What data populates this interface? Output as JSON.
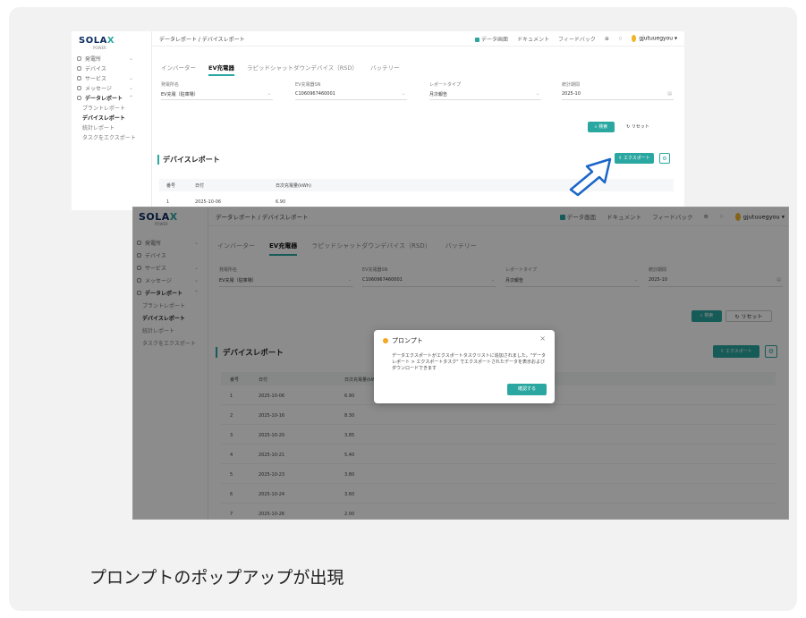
{
  "caption": "プロンプトのポップアップが出現",
  "colors": {
    "accent": "#2aa7a0",
    "card_bg": "#f2f2f2",
    "warning": "#f5a623",
    "arrow": "#1a66c8"
  },
  "logo": {
    "text_a": "SOLA",
    "text_x": "X",
    "sub": "POWER"
  },
  "header": {
    "breadcrumb": "データレポート / デバイスレポート",
    "data_screen": "データ画面",
    "documents": "ドキュメント",
    "feedback": "フィードバック",
    "username": "gjutuuegyou"
  },
  "sidebar": {
    "items": [
      {
        "label": "発電所"
      },
      {
        "label": "デバイス"
      },
      {
        "label": "サービス"
      },
      {
        "label": "メッセージ"
      },
      {
        "label": "データレポート"
      },
      {
        "label": "プラントレポート"
      },
      {
        "label": "デバイスレポート"
      },
      {
        "label": "統計レポート"
      },
      {
        "label": "タスクをエクスポート"
      }
    ]
  },
  "tabs": [
    "インバーター",
    "EV充電器",
    "ラピッドシャットダウンデバイス（RSD）",
    "バッテリー"
  ],
  "filters": {
    "plant_label": "発電所名",
    "plant_value": "EV充電（駐車場）",
    "sn_label": "EV充電器SN",
    "sn_value": "C1060967460001",
    "type_label": "レポートタイプ",
    "type_value": "月次報告",
    "period_label": "統計期間",
    "period_value": "2025-10"
  },
  "buttons": {
    "search": "検索",
    "reset": "リセット",
    "export": "エクスポート",
    "gear": "⚙"
  },
  "report": {
    "title": "デバイスレポート",
    "columns": [
      "番号",
      "日付",
      "日次充電量(kWh)"
    ],
    "rows_back": [
      {
        "no": "1",
        "date": "2025-10-06",
        "kwh": "6.90"
      }
    ],
    "rows_front": [
      {
        "no": "1",
        "date": "2025-10-06",
        "kwh": "6.90"
      },
      {
        "no": "2",
        "date": "2025-10-16",
        "kwh": "8.30"
      },
      {
        "no": "3",
        "date": "2025-10-20",
        "kwh": "3.85"
      },
      {
        "no": "4",
        "date": "2025-10-21",
        "kwh": "5.40"
      },
      {
        "no": "5",
        "date": "2025-10-23",
        "kwh": "3.80"
      },
      {
        "no": "6",
        "date": "2025-10-24",
        "kwh": "3.60"
      },
      {
        "no": "7",
        "date": "2025-10-26",
        "kwh": "2.00"
      }
    ]
  },
  "modal": {
    "title": "プロンプト",
    "body": "データエクスポートがエクスポートタスクリストに追加されました。\"データレポート > エクスポートタスク\" でエクスポートされたデータを表示およびダウンロードできます",
    "ok": "確認する",
    "close": "×"
  }
}
